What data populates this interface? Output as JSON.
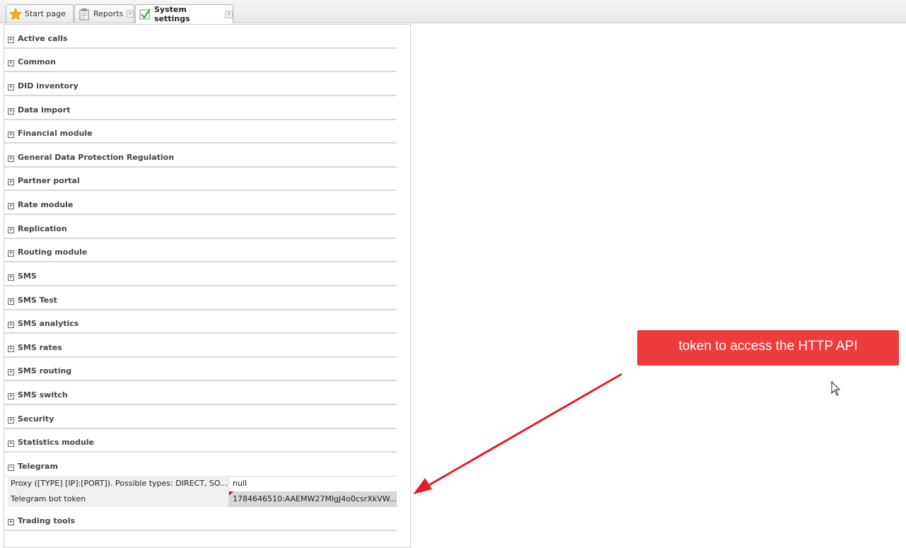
{
  "tabs": [
    {
      "label": "Start page",
      "icon": "star-icon",
      "closable": false,
      "active": false
    },
    {
      "label": "Reports",
      "icon": "clipboard-icon",
      "closable": true,
      "active": false
    },
    {
      "label": "System settings",
      "icon": "checklist-icon",
      "closable": true,
      "active": true
    }
  ],
  "sections": [
    {
      "label": "Active calls",
      "expanded": false
    },
    {
      "label": "Common",
      "expanded": false
    },
    {
      "label": "DID inventory",
      "expanded": false
    },
    {
      "label": "Data import",
      "expanded": false
    },
    {
      "label": "Financial module",
      "expanded": false
    },
    {
      "label": "General Data Protection Regulation",
      "expanded": false
    },
    {
      "label": "Partner portal",
      "expanded": false
    },
    {
      "label": "Rate module",
      "expanded": false
    },
    {
      "label": "Replication",
      "expanded": false
    },
    {
      "label": "Routing module",
      "expanded": false
    },
    {
      "label": "SMS",
      "expanded": false
    },
    {
      "label": "SMS Test",
      "expanded": false
    },
    {
      "label": "SMS analytics",
      "expanded": false
    },
    {
      "label": "SMS rates",
      "expanded": false
    },
    {
      "label": "SMS routing",
      "expanded": false
    },
    {
      "label": "SMS switch",
      "expanded": false
    },
    {
      "label": "Security",
      "expanded": false
    },
    {
      "label": "Statistics module",
      "expanded": false
    },
    {
      "label": "Telegram",
      "expanded": true
    },
    {
      "label": "Trading tools",
      "expanded": false
    }
  ],
  "telegram_properties": [
    {
      "key": "Proxy ([TYPE] [IP]:[PORT]). Possible types: DIRECT, SO...",
      "value": "null"
    },
    {
      "key": "Telegram bot token",
      "value": "1784646510:AAEMW27MlgJ4o0csrXkVW..."
    }
  ],
  "callout": {
    "text": "token to access the HTTP API",
    "color": "#ee3b3b"
  },
  "icons": {
    "collapsed": "plus-box-icon",
    "expanded": "minus-box-icon"
  }
}
